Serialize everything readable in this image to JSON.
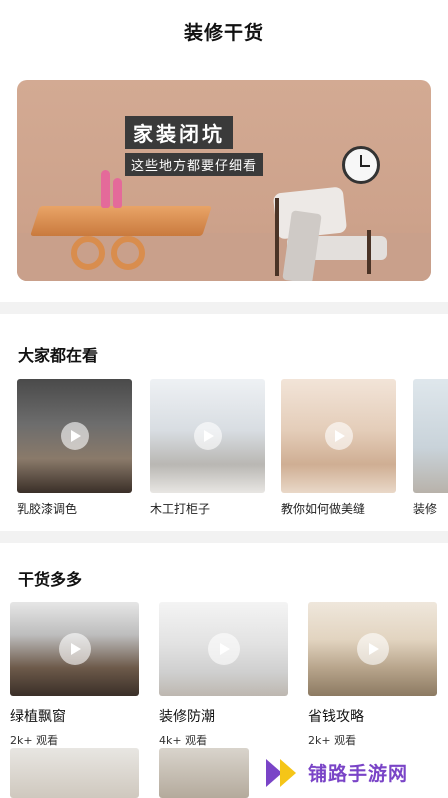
{
  "header": {
    "title": "装修干货"
  },
  "banner": {
    "title": "家装闭坑",
    "subtitle": "这些地方都要仔细看"
  },
  "trending": {
    "title": "大家都在看",
    "items": [
      {
        "label": "乳胶漆调色"
      },
      {
        "label": "木工打柜子"
      },
      {
        "label": "教你如何做美缝"
      },
      {
        "label": "装修"
      }
    ]
  },
  "tips": {
    "title": "干货多多",
    "items": [
      {
        "title": "绿植飘窗",
        "count": "2k+ 观看"
      },
      {
        "title": "装修防潮",
        "count": "4k+ 观看"
      },
      {
        "title": "省钱攻略",
        "count": "2k+ 观看"
      }
    ]
  },
  "watermark": {
    "text": "铺路手游网"
  },
  "colors": {
    "accent": "#7a44c7",
    "watermark_yellow": "#f5c518",
    "divider": "#f2f2f2"
  }
}
